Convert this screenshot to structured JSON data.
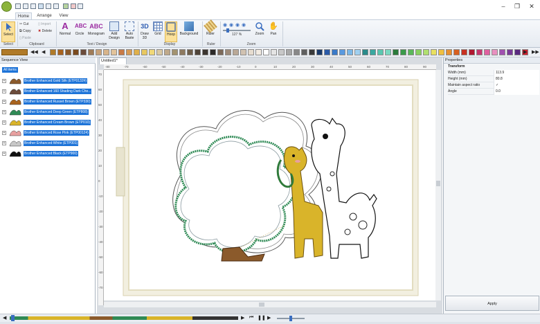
{
  "tabs": [
    "Home",
    "Arrange",
    "View"
  ],
  "ribbon": {
    "select": "Select",
    "cut": "Cut",
    "copy": "Copy",
    "paste": "Paste",
    "import": "Import",
    "delete": "Delete",
    "normal": "Normal",
    "circle": "Circle",
    "monogram": "Monogram",
    "add_design": "Add Design",
    "auto_baste": "Auto Baste",
    "draw3d": "Draw 3D",
    "grid": "Grid",
    "hoop": "Hoop",
    "background": "Background",
    "ruler": "Ruler",
    "zoom": "Zoom",
    "pan": "Pan",
    "zoom_pct": "127 %",
    "groups": {
      "select": "Select",
      "clipboard": "Clipboard",
      "text_design": "Text / Design",
      "display": "Display",
      "ruler": "Ruler",
      "zoom": "Zoom"
    }
  },
  "palette_colors": [
    "#b07a28",
    "#a9631e",
    "#8b5a2b",
    "#7a4a1e",
    "#6b4b3a",
    "#a07c58",
    "#c8a27a",
    "#d8b48a",
    "#e2c39a",
    "#c97b47",
    "#d89b55",
    "#e0b04a",
    "#e8c860",
    "#f0d878",
    "#d9c9a3",
    "#bfa98a",
    "#a39370",
    "#8e7a60",
    "#6e5e4a",
    "#4e4338",
    "#3b3530",
    "#2c2a28",
    "#7d6a5a",
    "#9e8b7a",
    "#b9a896",
    "#d1c2b1",
    "#e6dccf",
    "#f2ebe2",
    "#ffffff",
    "#e4e4e4",
    "#c8c8c8",
    "#a8a8a8",
    "#888888",
    "#5f5f5f",
    "#3a3a3a",
    "#1a3a6a",
    "#2a5aa8",
    "#3a7ac8",
    "#5a9ae0",
    "#7ab8e8",
    "#a0d0f0",
    "#2a8a8a",
    "#3aa8a0",
    "#5ac8b0",
    "#7ad8c0",
    "#2a7a3a",
    "#3a9a4a",
    "#5ab85a",
    "#88d060",
    "#b0e070",
    "#e8e060",
    "#f0c040",
    "#e89030",
    "#d86020",
    "#c83020",
    "#b01830",
    "#c83870",
    "#e060a0",
    "#e890c0",
    "#a050b0",
    "#7a3a98",
    "#5a2a80",
    "#d02030"
  ],
  "sequence": {
    "title": "Sequence View",
    "all": "All items",
    "items": [
      "Brother Enhanced:Gold Silk (ETP0132#)",
      "Brother Enhanced:160 Shading Dark Cho...",
      "Brother Enhanced:Russet Brown (ETP330)",
      "Brother Enhanced:Deep Green (ETP808)",
      "Brother Enhanced:Cream Brown (ETP010)",
      "Brother Enhanced:Rose Pink (ETP00124)",
      "Brother Enhanced:White (ETP001)",
      "Brother Enhanced:Black (ETP900)"
    ]
  },
  "document": {
    "tab": "Untitled1*"
  },
  "ruler_labels": [
    "-80",
    "-70",
    "-60",
    "-50",
    "-40",
    "-30",
    "-20",
    "-10",
    "0",
    "10",
    "20",
    "30",
    "40",
    "50",
    "60",
    "70",
    "80",
    "90"
  ],
  "vruler_labels": [
    "70",
    "60",
    "50",
    "40",
    "30",
    "20",
    "10",
    "0",
    "-10",
    "-20",
    "-30",
    "-40",
    "-50",
    "-60",
    "-70"
  ],
  "properties": {
    "title": "Properties",
    "section": "Transform",
    "rows": [
      {
        "label": "Width (mm)",
        "value": "113.9"
      },
      {
        "label": "Height (mm)",
        "value": "80.8"
      },
      {
        "label": "Maintain aspect ratio",
        "value": "✓"
      },
      {
        "label": "Angle",
        "value": "0.0"
      }
    ],
    "apply": "Apply"
  }
}
